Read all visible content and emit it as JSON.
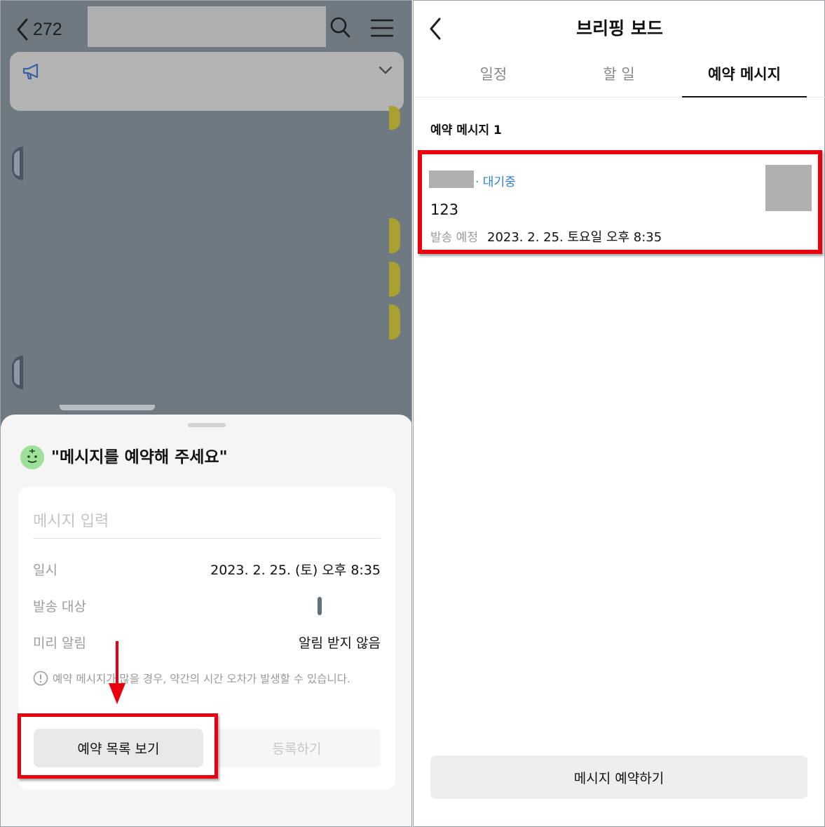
{
  "left": {
    "header": {
      "back_count": "272"
    },
    "sheet": {
      "title": "\"메시지를 예약해 주세요\"",
      "message_placeholder": "메시지 입력",
      "rows": [
        {
          "label": "일시",
          "value": "2023. 2. 25. (토) 오후 8:35"
        },
        {
          "label": "발송 대상",
          "value": ""
        },
        {
          "label": "미리 알림",
          "value": "알림 받지 않음"
        }
      ],
      "notice": "예약 메시지가 많을 경우, 약간의 시간 오차가 발생할 수 있습니다.",
      "view_list_button": "예약 목록 보기",
      "register_button": "등록하기"
    }
  },
  "right": {
    "title": "브리핑 보드",
    "tabs": [
      {
        "label": "일정",
        "active": false
      },
      {
        "label": "할 일",
        "active": false
      },
      {
        "label": "예약 메시지",
        "active": true
      }
    ],
    "section_title": "예약 메시지 1",
    "card": {
      "status": "· 대기중",
      "message": "123",
      "send_label": "발송 예정",
      "send_time": "2023. 2. 25. 토요일 오후 8:35"
    },
    "reserve_button": "메시지 예약하기"
  },
  "colors": {
    "highlight": "#e8000e",
    "status_blue": "#2f7fd1",
    "overlay": "#6f7982"
  },
  "icons": [
    "back-icon",
    "search-icon",
    "menu-icon",
    "megaphone-icon",
    "chevron-down-icon",
    "info-icon",
    "emoji-icon",
    "arrow-down-icon"
  ]
}
